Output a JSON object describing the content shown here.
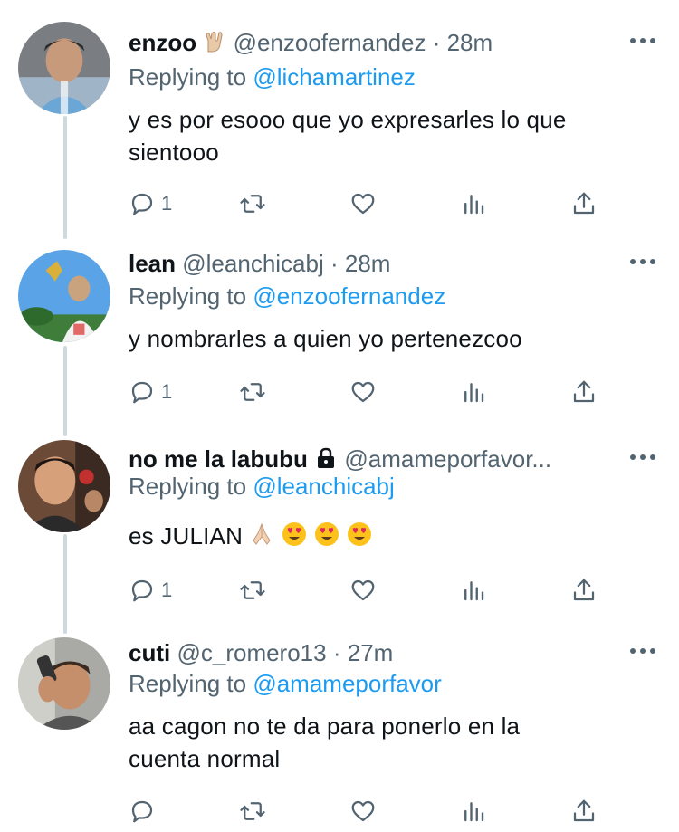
{
  "tweets": [
    {
      "name": "enzoo",
      "name_emoji": "rock-hand-emoji",
      "handle": "@enzoofernandez",
      "dot": "·",
      "time": "28m",
      "reply_prefix": "Replying to",
      "reply_to": "@lichamartinez",
      "text_line1": "y es por esooo que yo expresarles lo que",
      "text_line2": "sientooo",
      "reply_count": "1",
      "retweet_count": "",
      "like_count": ""
    },
    {
      "name": "lean",
      "handle": "@leanchicabj",
      "dot": "·",
      "time": "28m",
      "reply_prefix": "Replying to",
      "reply_to": "@enzoofernandez",
      "text_line1": "y nombrarles a quien yo pertenezcoo",
      "reply_count": "1"
    },
    {
      "name": "no me la labubu",
      "name_icon": "lock-icon",
      "handle": "@amameporfavor...",
      "reply_prefix": "Replying to",
      "reply_to": "@leanchicabj",
      "text_line1": "es JULIAN",
      "text_emojis": [
        "praying-hands-emoji",
        "heart-eyes-emoji",
        "heart-eyes-emoji",
        "heart-eyes-emoji"
      ],
      "reply_count": "1"
    },
    {
      "name": "cuti",
      "handle": "@c_romero13",
      "dot": "·",
      "time": "27m",
      "reply_prefix": "Replying to",
      "reply_to": "@amameporfavor",
      "text_line1": "aa cagon no te da para ponerlo en la",
      "text_line2": "cuenta normal",
      "reply_count": ""
    }
  ],
  "icons": {
    "reply": "reply-icon",
    "retweet": "retweet-icon",
    "like": "heart-icon",
    "views": "analytics-icon",
    "share": "share-icon",
    "more": "more-options-icon"
  },
  "colors": {
    "name": "#0f1419",
    "secondary": "#536471",
    "mention": "#1d9bf0",
    "thread_line": "#cfd9de"
  }
}
